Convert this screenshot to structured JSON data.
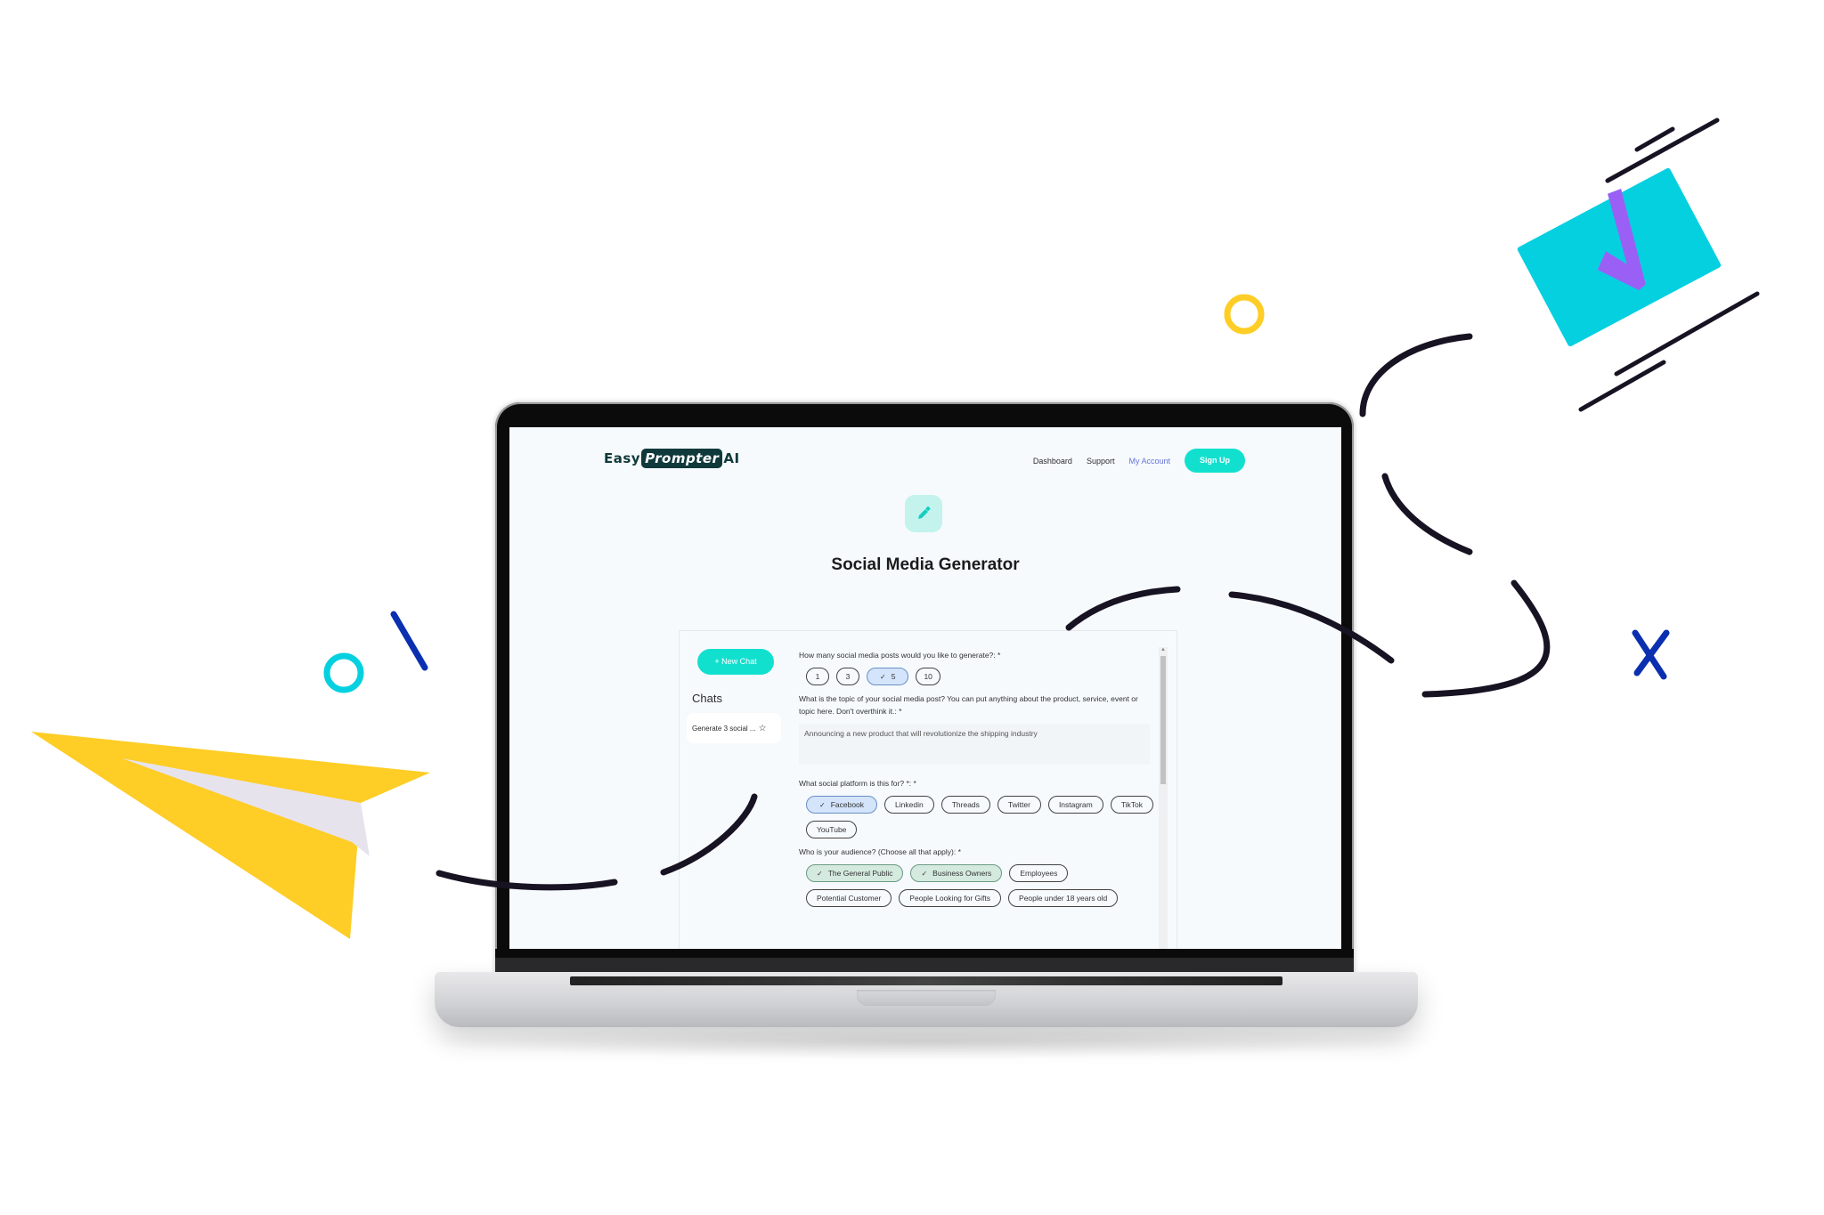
{
  "brand": {
    "easy": "Easy",
    "prompter": "Prompter",
    "ai": "AI"
  },
  "nav": {
    "dashboard": "Dashboard",
    "support": "Support",
    "account": "My Account",
    "signup": "Sign Up"
  },
  "page": {
    "title": "Social Media Generator",
    "icon": "pen-icon"
  },
  "sidebar": {
    "new_chat": "+ New Chat",
    "chats_heading": "Chats",
    "chat_items": [
      {
        "label": "Generate 3 social ...",
        "icon": "star-icon"
      }
    ]
  },
  "form": {
    "q_count": "How many social media posts would you like to generate?: *",
    "counts": [
      {
        "label": "1",
        "selected": false
      },
      {
        "label": "3",
        "selected": false
      },
      {
        "label": "5",
        "selected": true
      },
      {
        "label": "10",
        "selected": false
      }
    ],
    "q_topic": "What is the topic of your social media post? You can put anything about the product, service, event or topic here. Don't overthink it.: *",
    "topic_value": "Announcing a new product that will revolutionize the shipping industry",
    "q_platform": "What social platform is this for? *: *",
    "platforms": [
      {
        "label": "Facebook",
        "selected": true
      },
      {
        "label": "Linkedin",
        "selected": false
      },
      {
        "label": "Threads",
        "selected": false
      },
      {
        "label": "Twitter",
        "selected": false
      },
      {
        "label": "Instagram",
        "selected": false
      },
      {
        "label": "TikTok",
        "selected": false
      },
      {
        "label": "YouTube",
        "selected": false
      }
    ],
    "q_audience": "Who is your audience? (Choose all that apply): *",
    "audiences": [
      {
        "label": "The General Public",
        "selected": true
      },
      {
        "label": "Business Owners",
        "selected": true
      },
      {
        "label": "Employees",
        "selected": false
      },
      {
        "label": "Potential Customer",
        "selected": false
      },
      {
        "label": "People Looking for Gifts",
        "selected": false
      },
      {
        "label": "People under 18 years old",
        "selected": false
      }
    ]
  },
  "colors": {
    "accent": "#12e0cf",
    "brand_dark": "#10393b",
    "account_link": "#6675d9",
    "selected_blue": "#d3e4fb",
    "selected_green": "#d4eadf",
    "deco_yellow": "#fecd26",
    "deco_cyan": "#05d0e0",
    "deco_purple": "#9a60f5",
    "deco_navy": "#0a30b0",
    "deco_ink": "#181322"
  }
}
